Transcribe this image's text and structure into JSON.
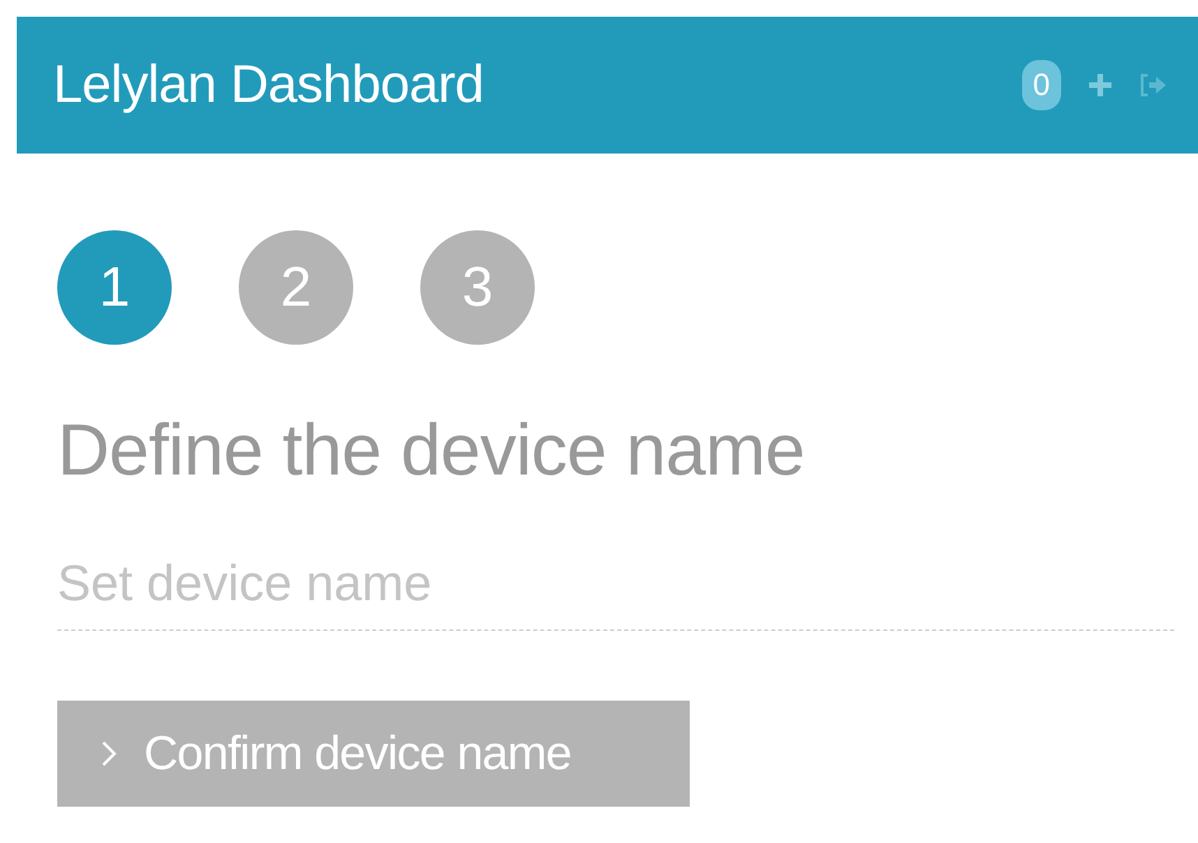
{
  "header": {
    "title": "Lelylan Dashboard",
    "badge": "0"
  },
  "steps": [
    {
      "label": "1",
      "selected": true
    },
    {
      "label": "2",
      "selected": false
    },
    {
      "label": "3",
      "selected": false
    }
  ],
  "heading": "Define the device name",
  "name_field": {
    "placeholder": "Set device name"
  },
  "confirm_button": {
    "label": "Confirm device name",
    "disabled": true
  }
}
